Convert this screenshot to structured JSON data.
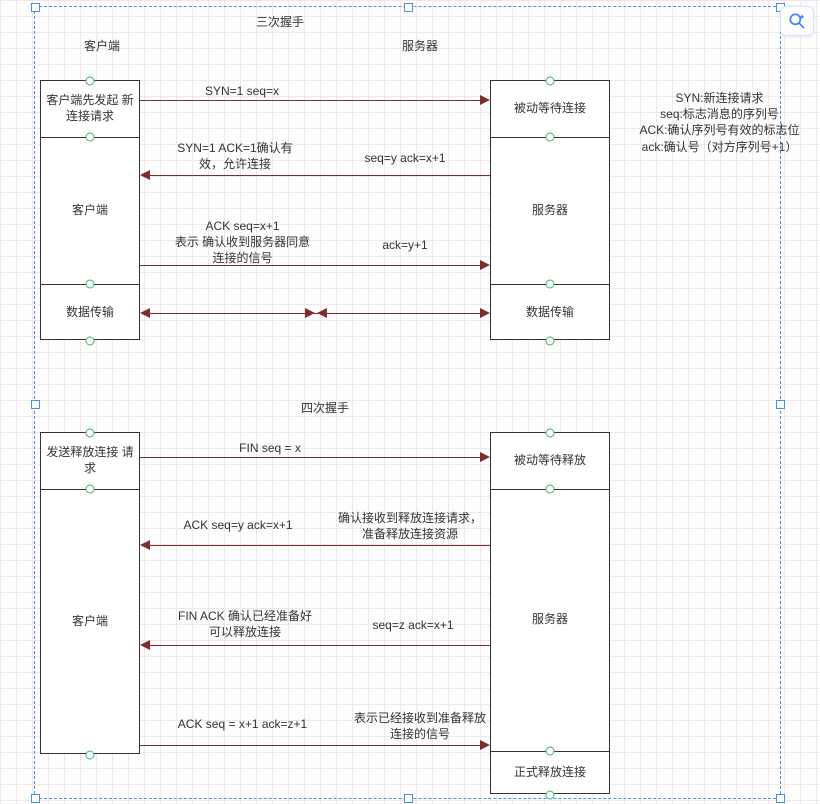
{
  "titles": {
    "three_way": "三次握手",
    "four_way": "四次握手"
  },
  "headers": {
    "client": "客户端",
    "server": "服务器"
  },
  "three_way": {
    "client_box": {
      "states": [
        "客户端先发起\n新连接请求",
        "客户端",
        "数据传输"
      ]
    },
    "server_box": {
      "states": [
        "被动等待连接",
        "服务器",
        "数据传输"
      ]
    },
    "arrows": {
      "a1_label": "SYN=1 seq=x",
      "a2_label_left": "SYN=1 ACK=1确认有\n效，允许连接",
      "a2_label_right": "seq=y ack=x+1",
      "a3_label_left": "ACK seq=x+1\n表示 确认收到服务器同意\n连接的信号",
      "a3_label_right": "ack=y+1"
    }
  },
  "four_way": {
    "client_box": {
      "states": [
        "发送释放连接\n请求",
        "客户端"
      ]
    },
    "server_box": {
      "states": [
        "被动等待释放",
        "服务器",
        "正式释放连接"
      ]
    },
    "arrows": {
      "a1_label": "FIN seq = x",
      "a2_label_left": "ACK seq=y ack=x+1",
      "a2_label_right": "确认接收到释放连接请求，\n准备释放连接资源",
      "a3_label_left": "FIN ACK 确认已经准备好\n可以释放连接",
      "a3_label_right": "seq=z ack=x+1",
      "a4_label_left": "ACK seq = x+1 ack=z+1",
      "a4_label_right": "表示已经接收到准备释放\n连接的信号"
    }
  },
  "legend": "SYN:新连接请求\nseq:标志消息的序列号\nACK:确认序列号有效的标志位\nack:确认号（对方序列号+1）"
}
